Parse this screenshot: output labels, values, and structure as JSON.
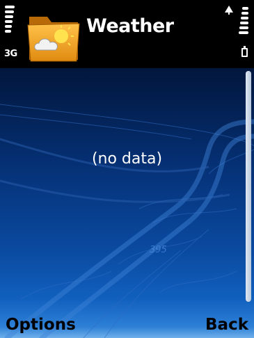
{
  "status_bar": {
    "network": "3G",
    "signal_bars": 6,
    "battery_bars": 6
  },
  "app": {
    "title": "Weather",
    "icon": "weather-folder-icon"
  },
  "content": {
    "message": "(no data)",
    "background_map_label": "395"
  },
  "softkeys": {
    "left": "Options",
    "right": "Back"
  },
  "colors": {
    "background_top": "#00081c",
    "background_bottom": "#2d80d6",
    "text": "#ffffff",
    "softkey_text": "#000000"
  }
}
